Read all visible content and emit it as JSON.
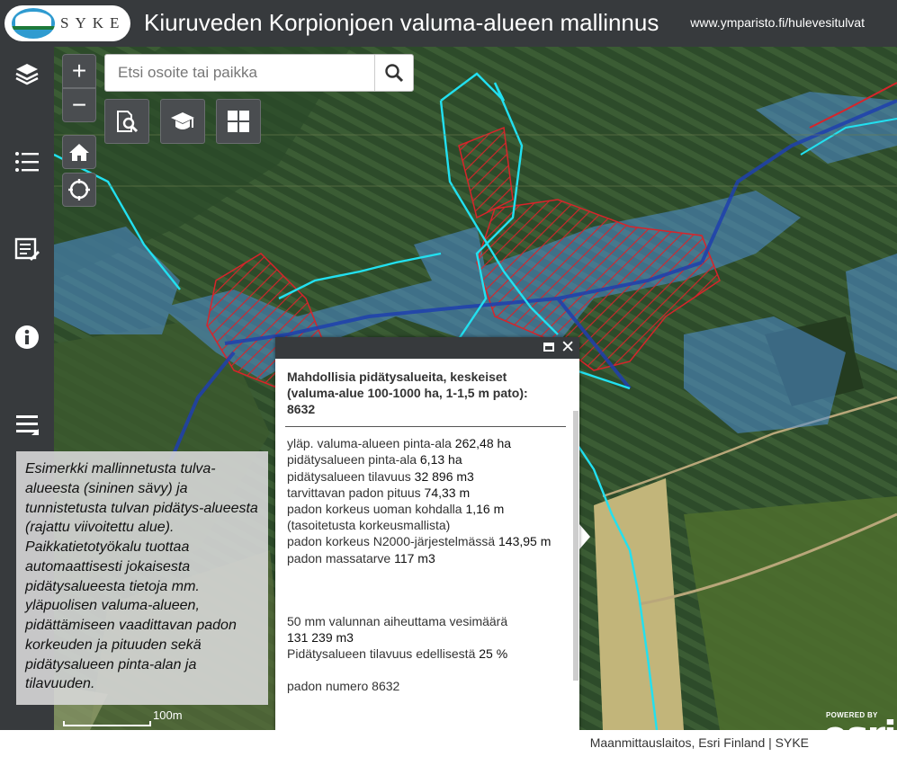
{
  "header": {
    "logo_text": "SYKE",
    "title": "Kiuruveden Korpionjoen valuma-alueen mallinnus",
    "link": "www.ymparisto.fi/hulevesitulvat"
  },
  "sidebar": {
    "items": [
      {
        "icon": "layers-icon"
      },
      {
        "icon": "legend-list-icon"
      },
      {
        "icon": "edit-note-icon"
      },
      {
        "icon": "info-icon"
      },
      {
        "icon": "menu-icon"
      }
    ]
  },
  "map_controls": {
    "zoom_in": "+",
    "zoom_out": "−"
  },
  "search": {
    "placeholder": "Etsi osoite tai paikka"
  },
  "caption": {
    "text": "Esimerkki mallinnetusta tulva-alueesta (sininen sävy) ja tunnistetusta tulvan pidätys-alueesta (rajattu viivoitettu alue). Paikkatietotyökalu tuottaa automaattisesti jokaisesta pidätysalueesta tietoja mm. yläpuolisen valuma-alueen, pidättämiseen vaadittavan padon korkeuden ja pituuden sekä pidätysalueen pinta-alan ja tilavuuden."
  },
  "scalebar": {
    "label": "100m"
  },
  "popup": {
    "title": "Mahdollisia pidätysalueita, keskeiset (valuma-alue 100-1000 ha, 1-1,5 m pato): 8632",
    "lines": [
      {
        "label": "yläp. valuma-alueen pinta-ala ",
        "value": "262,48 ha"
      },
      {
        "label": "pidätysalueen pinta-ala ",
        "value": "6,13 ha"
      },
      {
        "label": "pidätysalueen tilavuus ",
        "value": "32 896 m3"
      },
      {
        "label": "tarvittavan padon pituus ",
        "value": "74,33 m"
      },
      {
        "label": "padon korkeus uoman kohdalla ",
        "value": "1,16 m"
      },
      {
        "label": "(tasoitetusta korkeusmallista)",
        "value": ""
      },
      {
        "label": "padon korkeus N2000-järjestelmässä ",
        "value": "143,95 m"
      },
      {
        "label": "padon massatarve ",
        "value": "117 m3"
      }
    ],
    "water_label": "50 mm valunnan aiheuttama vesimäärä",
    "water_value": "131 239 m3",
    "ratio_label": "Pidätysalueen tilavuus edellisestä ",
    "ratio_value": "25 %",
    "dam_number": "padon numero 8632"
  },
  "footer": {
    "attribution": "Maanmittauslaitos, Esri Finland | SYKE",
    "esri_powered": "POWERED BY",
    "esri_word": "esri"
  },
  "colors": {
    "header_bg": "#373a3d",
    "flood_blue": "#4f8fd6",
    "boundary_cyan": "#22e0f0",
    "retention_red": "#d8242a"
  }
}
